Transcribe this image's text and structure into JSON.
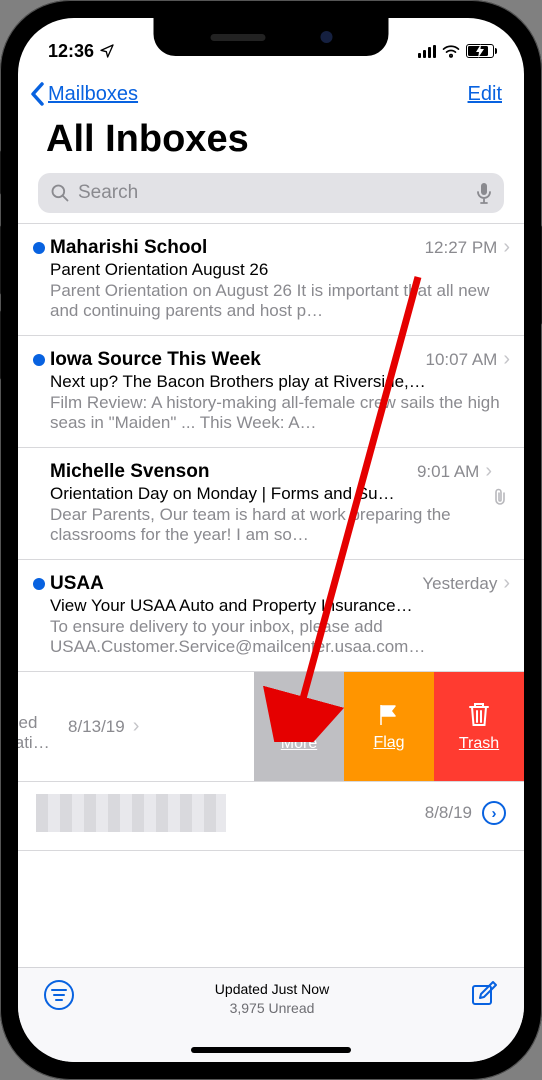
{
  "status": {
    "time": "12:36"
  },
  "nav": {
    "back_label": "Mailboxes",
    "edit_label": "Edit"
  },
  "title": "All Inboxes",
  "search": {
    "placeholder": "Search"
  },
  "emails": [
    {
      "unread": true,
      "sender": "Maharishi School",
      "time": "12:27 PM",
      "subject": "Parent Orientation August 26",
      "preview": "Parent Orientation on August 26 It is important that all new and continuing parents and host p…",
      "attachment": false
    },
    {
      "unread": true,
      "sender": "Iowa Source This Week",
      "time": "10:07 AM",
      "subject": "Next up? The Bacon Brothers play at Riverside,…",
      "preview": "Film Review: A history-making all-female crew sails the high seas in \"Maiden\" ... This Week: A…",
      "attachment": false
    },
    {
      "unread": false,
      "sender": "Michelle Svenson",
      "time": "9:01 AM",
      "subject": "Orientation Day on Monday | Forms and Su…",
      "preview": "Dear Parents, Our team is hard at work preparing the classrooms for the year! I am so…",
      "attachment": true
    },
    {
      "unread": true,
      "sender": "USAA",
      "time": "Yesterday",
      "subject": "View Your USAA Auto and Property Insurance…",
      "preview": "To ensure delivery to your inbox, please add USAA.Customer.Service@mailcenter.usaa.com…",
      "attachment": false
    }
  ],
  "swipe": {
    "time": "8/13/19",
    "preview_l1": "urgery scheduled",
    "preview_l2": "nts in the operati…",
    "more_label": "More",
    "flag_label": "Flag",
    "trash_label": "Trash"
  },
  "blurred_row": {
    "time": "8/8/19"
  },
  "toolbar": {
    "status_line1": "Updated Just Now",
    "status_line2": "3,975 Unread"
  }
}
